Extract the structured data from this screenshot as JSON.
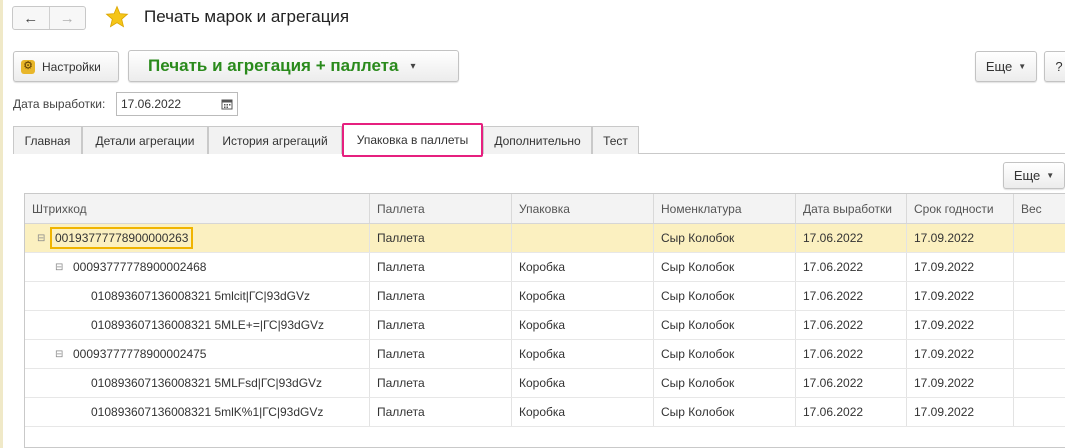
{
  "window": {
    "title": "Печать марок и агрегация",
    "back_glyph": "←",
    "forward_glyph": "→",
    "favorite_glyph": "★"
  },
  "toolbar": {
    "settings_label": "Настройки",
    "main_action_label": "Печать и агрегация + паллета",
    "main_action_caret": "▾",
    "more_label": "Еще",
    "help_label": "?"
  },
  "date_field": {
    "label": "Дата выработки:",
    "value": "17.06.2022"
  },
  "tabs": [
    {
      "label": "Главная",
      "active": false
    },
    {
      "label": "Детали агрегации",
      "active": false
    },
    {
      "label": "История агрегаций",
      "active": false
    },
    {
      "label": "Упаковка в паллеты",
      "active": true
    },
    {
      "label": "Дополнительно",
      "active": false
    },
    {
      "label": "Тест",
      "active": false
    }
  ],
  "table_commands": {
    "more_label": "Еще"
  },
  "table": {
    "columns": [
      "Штрихкод",
      "Паллета",
      "Упаковка",
      "Номенклатура",
      "Дата выработки",
      "Срок годности",
      "Вес"
    ],
    "rows": [
      {
        "barcode": "00193777778900000263",
        "pallet": "Паллета",
        "pack": "",
        "item": "Сыр Колобок",
        "date": "17.06.2022",
        "expiry": "17.09.2022",
        "weight": "",
        "level": 0,
        "toggle": "⊟"
      },
      {
        "barcode": "00093777778900002468",
        "pallet": "Паллета",
        "pack": "Коробка",
        "item": "Сыр Колобок",
        "date": "17.06.2022",
        "expiry": "17.09.2022",
        "weight": "",
        "level": 1,
        "toggle": "⊟"
      },
      {
        "barcode": "010893607136008321 5mlcit|ГС|93dGVz",
        "pallet": "Паллета",
        "pack": "Коробка",
        "item": "Сыр Колобок",
        "date": "17.06.2022",
        "expiry": "17.09.2022",
        "weight": "",
        "level": 2,
        "toggle": ""
      },
      {
        "barcode": "010893607136008321 5MLE+=|ГС|93dGVz",
        "pallet": "Паллета",
        "pack": "Коробка",
        "item": "Сыр Колобок",
        "date": "17.06.2022",
        "expiry": "17.09.2022",
        "weight": "",
        "level": 2,
        "toggle": ""
      },
      {
        "barcode": "00093777778900002475",
        "pallet": "Паллета",
        "pack": "Коробка",
        "item": "Сыр Колобок",
        "date": "17.06.2022",
        "expiry": "17.09.2022",
        "weight": "",
        "level": 1,
        "toggle": "⊟"
      },
      {
        "barcode": "010893607136008321 5MLFsd|ГС|93dGVz",
        "pallet": "Паллета",
        "pack": "Коробка",
        "item": "Сыр Колобок",
        "date": "17.06.2022",
        "expiry": "17.09.2022",
        "weight": "",
        "level": 2,
        "toggle": ""
      },
      {
        "barcode": "010893607136008321 5mlK%1|ГС|93dGVz",
        "pallet": "Паллета",
        "pack": "Коробка",
        "item": "Сыр Колобок",
        "date": "17.06.2022",
        "expiry": "17.09.2022",
        "weight": "",
        "level": 2,
        "toggle": ""
      }
    ]
  },
  "colors": {
    "main_action": "#2a8a1c",
    "active_tab_border": "#e6207f",
    "selected_row": "#fbf0c0",
    "focus_border": "#f0b400",
    "star": "#f5c518"
  },
  "icons": {
    "settings": "gear-icon",
    "calendar": "calendar-icon",
    "favorite": "star-icon",
    "tree_toggle": "collapse-icon"
  }
}
